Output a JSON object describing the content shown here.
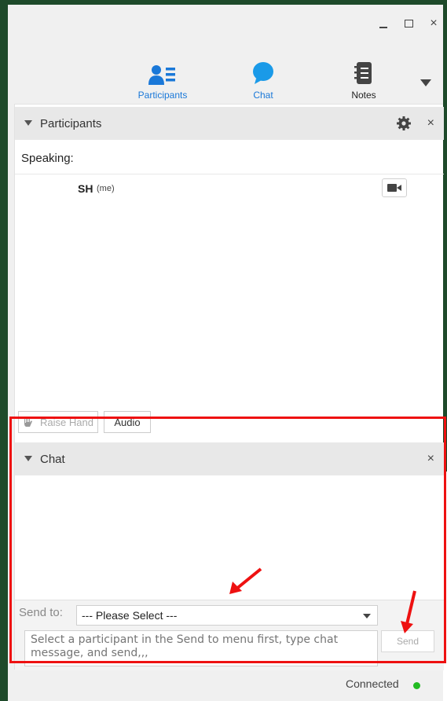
{
  "window": {
    "controls": {
      "minimize": "minimize",
      "maximize": "maximize",
      "close": "×"
    }
  },
  "toolbar": {
    "tabs": [
      {
        "label": "Participants",
        "icon": "participants-icon",
        "active": true
      },
      {
        "label": "Chat",
        "icon": "chat-bubble-icon",
        "active": true
      },
      {
        "label": "Notes",
        "icon": "notebook-icon",
        "active": false
      }
    ],
    "more_icon": "chevron-down-icon"
  },
  "participants_panel": {
    "title": "Participants",
    "close": "×",
    "gear_icon": "gear-icon",
    "speaking_label": "Speaking:",
    "participants": [
      {
        "initials": "SH",
        "tag": "(me)",
        "video_icon": "camera-icon"
      }
    ],
    "raise_hand_label": "Raise Hand",
    "audio_label": "Audio"
  },
  "chat_panel": {
    "title": "Chat",
    "close": "×",
    "send_to_label": "Send to:",
    "select_value": "--- Please Select ---",
    "message_placeholder": "Select a participant in the Send to menu first, type chat message, and send,,,",
    "send_label": "Send"
  },
  "status": {
    "text": "Connected",
    "color": "#22bb22"
  },
  "annotation": {
    "highlight_color": "#ee1111"
  }
}
